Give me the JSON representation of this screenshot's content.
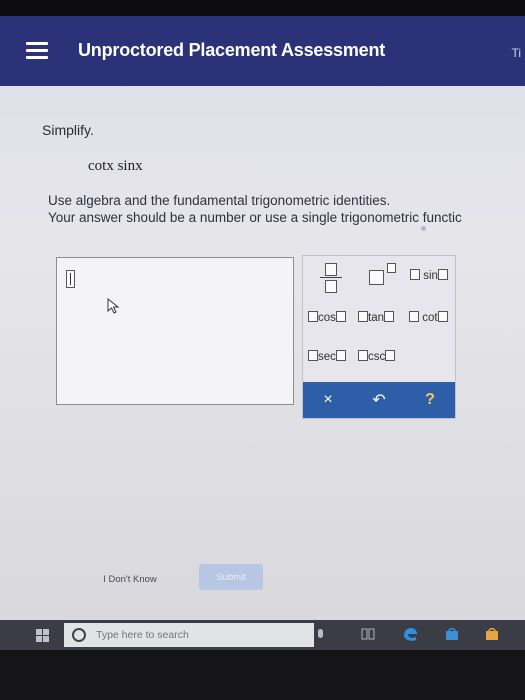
{
  "header": {
    "title": "Unproctored Placement Assessment",
    "right_text": "Ti"
  },
  "question": {
    "prompt": "Simplify.",
    "expression": "cotx sinx",
    "instructions_line1": "Use algebra and the fundamental trigonometric identities.",
    "instructions_line2": "Your answer should be a number or use a single trigonometric functic"
  },
  "keypad": {
    "sin": "sin",
    "cos": "cos",
    "tan": "tan",
    "cot": "cot",
    "sec": "sec",
    "csc": "csc",
    "clear": "×",
    "undo": "↶",
    "help": "?"
  },
  "actions": {
    "dont_know": "I Don't Know",
    "submit": "Submit"
  },
  "taskbar": {
    "search_placeholder": "Type here to search"
  },
  "colors": {
    "header_bg": "#2c3278",
    "keypad_action_bg": "#2f5ea8",
    "help_icon": "#f2c65a",
    "submit_bg": "#b7c6e2"
  }
}
